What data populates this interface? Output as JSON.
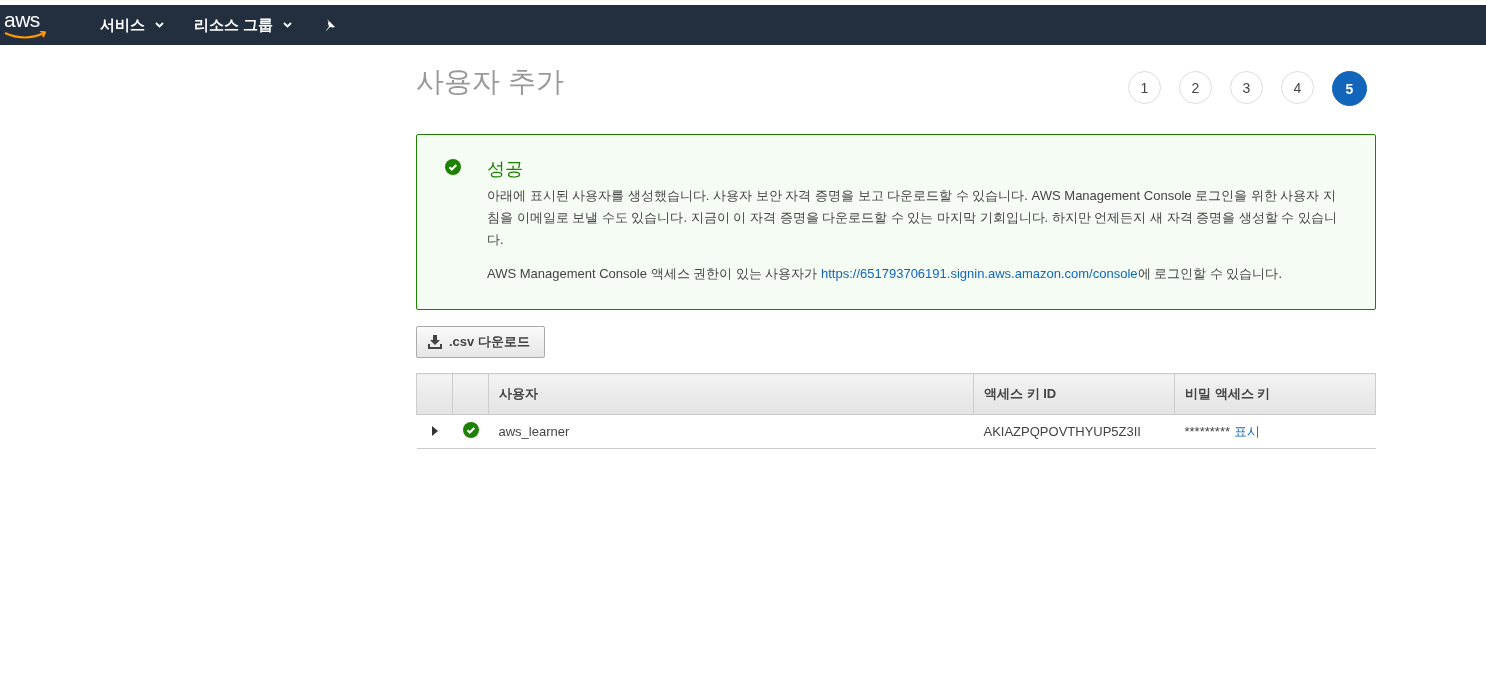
{
  "nav": {
    "logo": "aws",
    "menus": [
      {
        "label": "서비스"
      },
      {
        "label": "리소스 그룹"
      }
    ]
  },
  "page": {
    "title": "사용자 추가",
    "steps": [
      {
        "label": "1",
        "selected": false
      },
      {
        "label": "2",
        "selected": false
      },
      {
        "label": "3",
        "selected": false
      },
      {
        "label": "4",
        "selected": false
      },
      {
        "label": "5",
        "selected": true
      }
    ]
  },
  "alert": {
    "title": "성공",
    "message": "아래에 표시된 사용자를 생성했습니다. 사용자 보안 자격 증명을 보고 다운로드할 수 있습니다. AWS Management Console 로그인을 위한 사용자 지침을 이메일로 보낼 수도 있습니다. 지금이 이 자격 증명을 다운로드할 수 있는 마지막 기회입니다. 하지만 언제든지 새 자격 증명을 생성할 수 있습니다.",
    "login_prefix": "AWS Management Console 액세스 권한이 있는 사용자가 ",
    "login_link": "https://651793706191.signin.aws.amazon.com/console",
    "login_suffix": "에 로그인할 수 있습니다."
  },
  "download_button": ".csv 다운로드",
  "table": {
    "columns": [
      "사용자",
      "액세스 키 ID",
      "비밀 액세스 키"
    ],
    "rows": [
      {
        "expanded": false,
        "user": "aws_learner",
        "access_key_id": "AKIAZPQPOVTHYUP5Z3II",
        "secret": "*********",
        "show_link": "표시"
      }
    ]
  }
}
